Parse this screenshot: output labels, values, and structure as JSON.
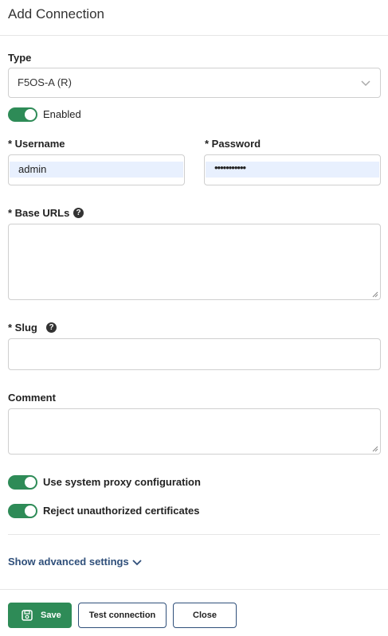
{
  "dialog": {
    "title": "Add Connection"
  },
  "type_field": {
    "label": "Type",
    "value": "F5OS-A (R)"
  },
  "enabled_toggle": {
    "label": "Enabled",
    "on": true
  },
  "username": {
    "label": "* Username",
    "value": "admin"
  },
  "password": {
    "label": "* Password",
    "value": "•••••••••••"
  },
  "base_urls": {
    "label": "* Base URLs",
    "value": ""
  },
  "slug": {
    "label": "* Slug",
    "value": ""
  },
  "comment": {
    "label": "Comment",
    "value": ""
  },
  "proxy_toggle": {
    "label": "Use system proxy configuration",
    "on": true
  },
  "reject_toggle": {
    "label": "Reject unauthorized certificates",
    "on": true
  },
  "advanced": {
    "label": "Show advanced settings"
  },
  "buttons": {
    "save": "Save",
    "test": "Test connection",
    "close": "Close"
  },
  "colors": {
    "accent_green": "#2e8b57",
    "link_blue": "#2f4f7a",
    "autofill": "#e8f0fe"
  }
}
